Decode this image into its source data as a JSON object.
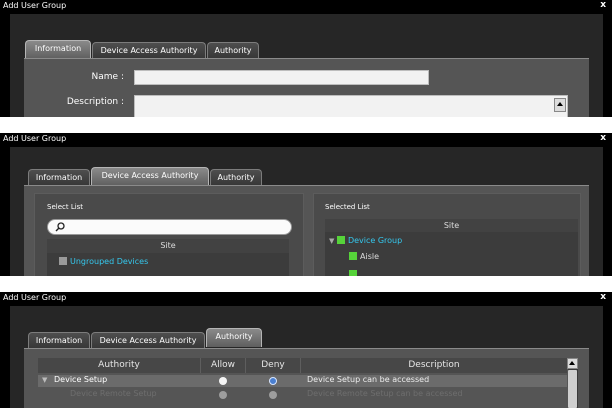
{
  "dialog": {
    "title": "Add User Group",
    "close_glyph": "x"
  },
  "tabs": [
    "Information",
    "Device Access Authority",
    "Authority"
  ],
  "information": {
    "name_label": "Name :",
    "name_value": "",
    "description_label": "Description :",
    "description_value": ""
  },
  "device_access": {
    "select_list_title": "Select List",
    "selected_list_title": "Selected List",
    "search_placeholder": "",
    "column_header": "Site",
    "select_items": [
      {
        "label": "Ungrouped Devices"
      }
    ],
    "selected_items": [
      {
        "label": "Device Group",
        "expanded": true
      },
      {
        "label": "Aisle"
      }
    ]
  },
  "authority": {
    "headers": {
      "authority": "Authority",
      "allow": "Allow",
      "deny": "Deny",
      "description": "Description"
    },
    "rows": [
      {
        "authority": "Device Setup",
        "description": "Device Setup can be accessed",
        "expanded": true,
        "selected": "deny"
      },
      {
        "authority": "Device Remote Setup",
        "description": "Device Remote Setup can be accessed",
        "selected": "none"
      }
    ]
  },
  "colors": {
    "accent_cyan": "#35c8ee",
    "cube_green": "#56d33a",
    "deny_blue": "#4a7fd0"
  }
}
